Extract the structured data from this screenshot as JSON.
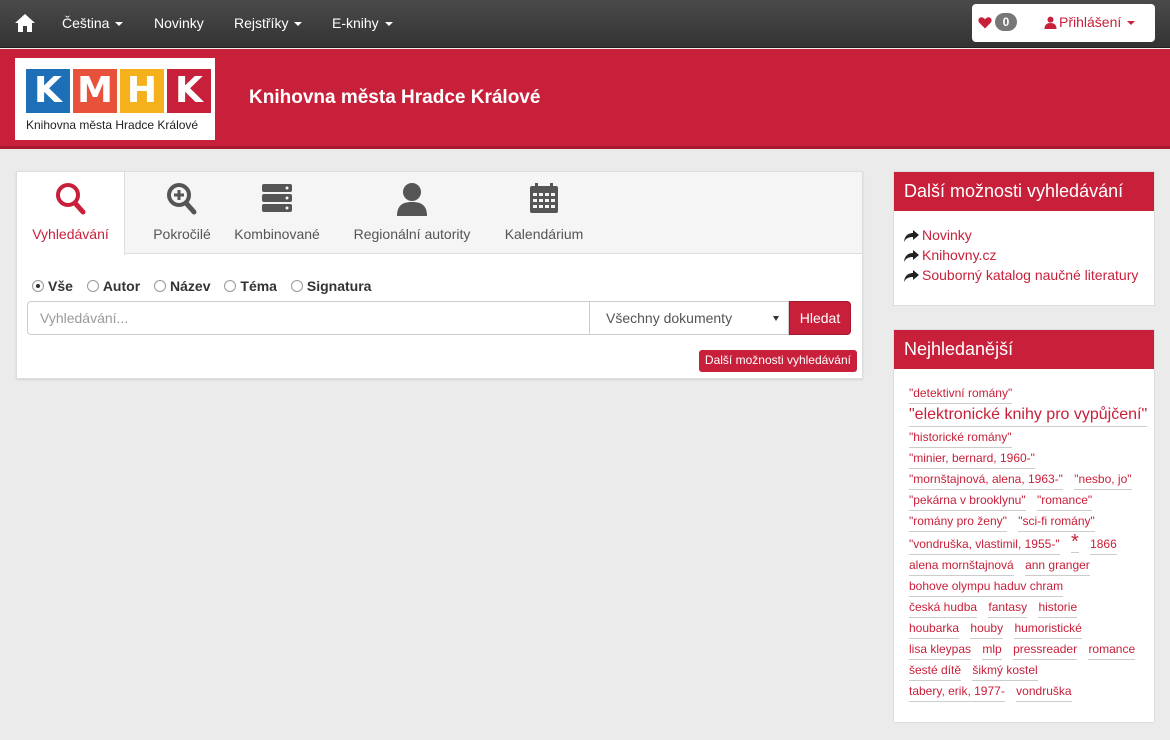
{
  "nav": {
    "items": [
      {
        "label": "Čeština",
        "caret": true
      },
      {
        "label": "Novinky",
        "caret": false
      },
      {
        "label": "Rejstříky",
        "caret": true
      },
      {
        "label": "E-knihy",
        "caret": true
      }
    ],
    "favorites_count": "0",
    "login_label": "Přihlášení"
  },
  "header": {
    "logo_letters": [
      "K",
      "M",
      "H",
      "K"
    ],
    "logo_caption": "Knihovna města Hradce Králové",
    "site_title": "Knihovna města Hradce Králové"
  },
  "search": {
    "tabs": [
      {
        "label": "Vyhledávání",
        "icon": "search-icon",
        "active": true
      },
      {
        "label": "Pokročilé",
        "icon": "zoom-plus-icon",
        "active": false
      },
      {
        "label": "Kombinované",
        "icon": "server-stack-icon",
        "active": false
      },
      {
        "label": "Regionální autority",
        "icon": "person-icon",
        "active": false
      },
      {
        "label": "Kalendárium",
        "icon": "calendar-icon",
        "active": false
      }
    ],
    "scopes": [
      {
        "label": "Vše",
        "checked": true
      },
      {
        "label": "Autor",
        "checked": false
      },
      {
        "label": "Název",
        "checked": false
      },
      {
        "label": "Téma",
        "checked": false
      },
      {
        "label": "Signatura",
        "checked": false
      }
    ],
    "placeholder": "Vyhledávání...",
    "value": "",
    "doc_type": "Všechny dokumenty",
    "submit_label": "Hledat",
    "more_label": "Další možnosti vyhledávání"
  },
  "sidebar": {
    "more_title": "Další možnosti vyhledávání",
    "links": [
      "Novinky",
      "Knihovny.cz",
      "Souborný katalog naučné literatury"
    ],
    "popular_title": "Nejhledanější",
    "tags": [
      {
        "text": "\"detektivní romány\"",
        "size": "normal"
      },
      {
        "text": "\"elektronické knihy pro vypůjčení\"",
        "size": "big"
      },
      {
        "text": "\"historické romány\"",
        "size": "normal"
      },
      {
        "text": "\"minier, bernard, 1960-\"",
        "size": "normal"
      },
      {
        "text": "\"mornštajnová, alena, 1963-\"",
        "size": "normal"
      },
      {
        "text": "\"nesbo, jo\"",
        "size": "normal"
      },
      {
        "text": "\"pekárna v brooklynu\"",
        "size": "normal"
      },
      {
        "text": "\"romance\"",
        "size": "normal"
      },
      {
        "text": "\"romány pro ženy\"",
        "size": "normal"
      },
      {
        "text": "\"sci-fi romány\"",
        "size": "normal"
      },
      {
        "text": "\"vondruška, vlastimil, 1955-\"",
        "size": "normal"
      },
      {
        "text": "*",
        "size": "star"
      },
      {
        "text": "1866",
        "size": "normal"
      },
      {
        "text": "alena mornštajnová",
        "size": "normal"
      },
      {
        "text": "ann granger",
        "size": "normal"
      },
      {
        "text": "bohove olympu haduv chram",
        "size": "normal"
      },
      {
        "text": "česká hudba",
        "size": "normal"
      },
      {
        "text": "fantasy",
        "size": "normal"
      },
      {
        "text": "historie",
        "size": "normal"
      },
      {
        "text": "houbarka",
        "size": "normal"
      },
      {
        "text": "houby",
        "size": "normal"
      },
      {
        "text": "humoristické",
        "size": "normal"
      },
      {
        "text": "lisa kleypas",
        "size": "normal"
      },
      {
        "text": "mlp",
        "size": "normal"
      },
      {
        "text": "pressreader",
        "size": "normal"
      },
      {
        "text": "romance",
        "size": "normal"
      },
      {
        "text": "šesté dítě",
        "size": "normal"
      },
      {
        "text": "šikmý kostel",
        "size": "normal"
      },
      {
        "text": "tabery, erik, 1977-",
        "size": "normal"
      },
      {
        "text": "vondruška",
        "size": "normal"
      }
    ]
  },
  "colors": {
    "brand_red": "#c8203a",
    "logo_tiles": [
      "#1d6fb8",
      "#e8513a",
      "#f4b11c",
      "#c8203a"
    ]
  }
}
